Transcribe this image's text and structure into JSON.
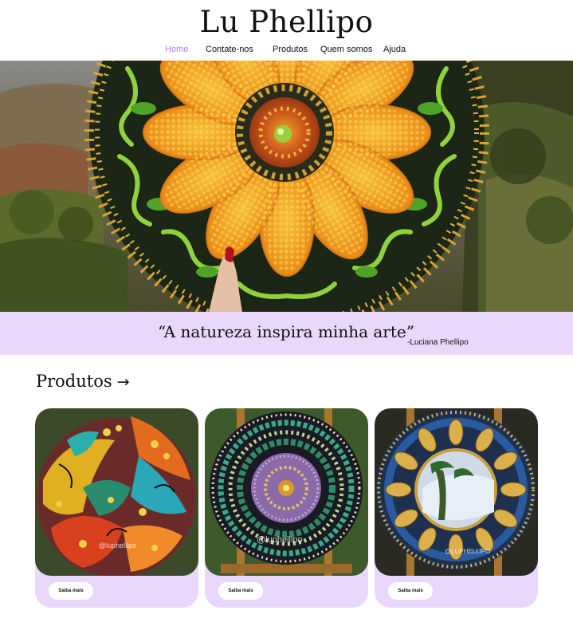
{
  "header": {
    "brand": "Lu Phellipo"
  },
  "nav": {
    "items": [
      {
        "label": "Home",
        "active": true
      },
      {
        "label": "Contate-nos",
        "active": false
      },
      {
        "label": "Produtos",
        "active": false
      },
      {
        "label": "Quem somos",
        "active": false
      },
      {
        "label": "Ajuda",
        "active": false
      }
    ]
  },
  "quote": {
    "text": "“A natureza inspira minha arte”",
    "author": "-Luciana Phellipo"
  },
  "products": {
    "title": "Produtos",
    "arrow": "→",
    "cards": [
      {
        "button_label": "Saiba mais",
        "watermark": "@luphellipo"
      },
      {
        "button_label": "Saiba mais",
        "watermark": "@luphellipo"
      },
      {
        "button_label": "Saiba mais",
        "watermark": "@LUPHELLIPO"
      }
    ]
  },
  "colors": {
    "accent": "#b37ef0",
    "band": "#ead8fc",
    "text": "#111111"
  }
}
